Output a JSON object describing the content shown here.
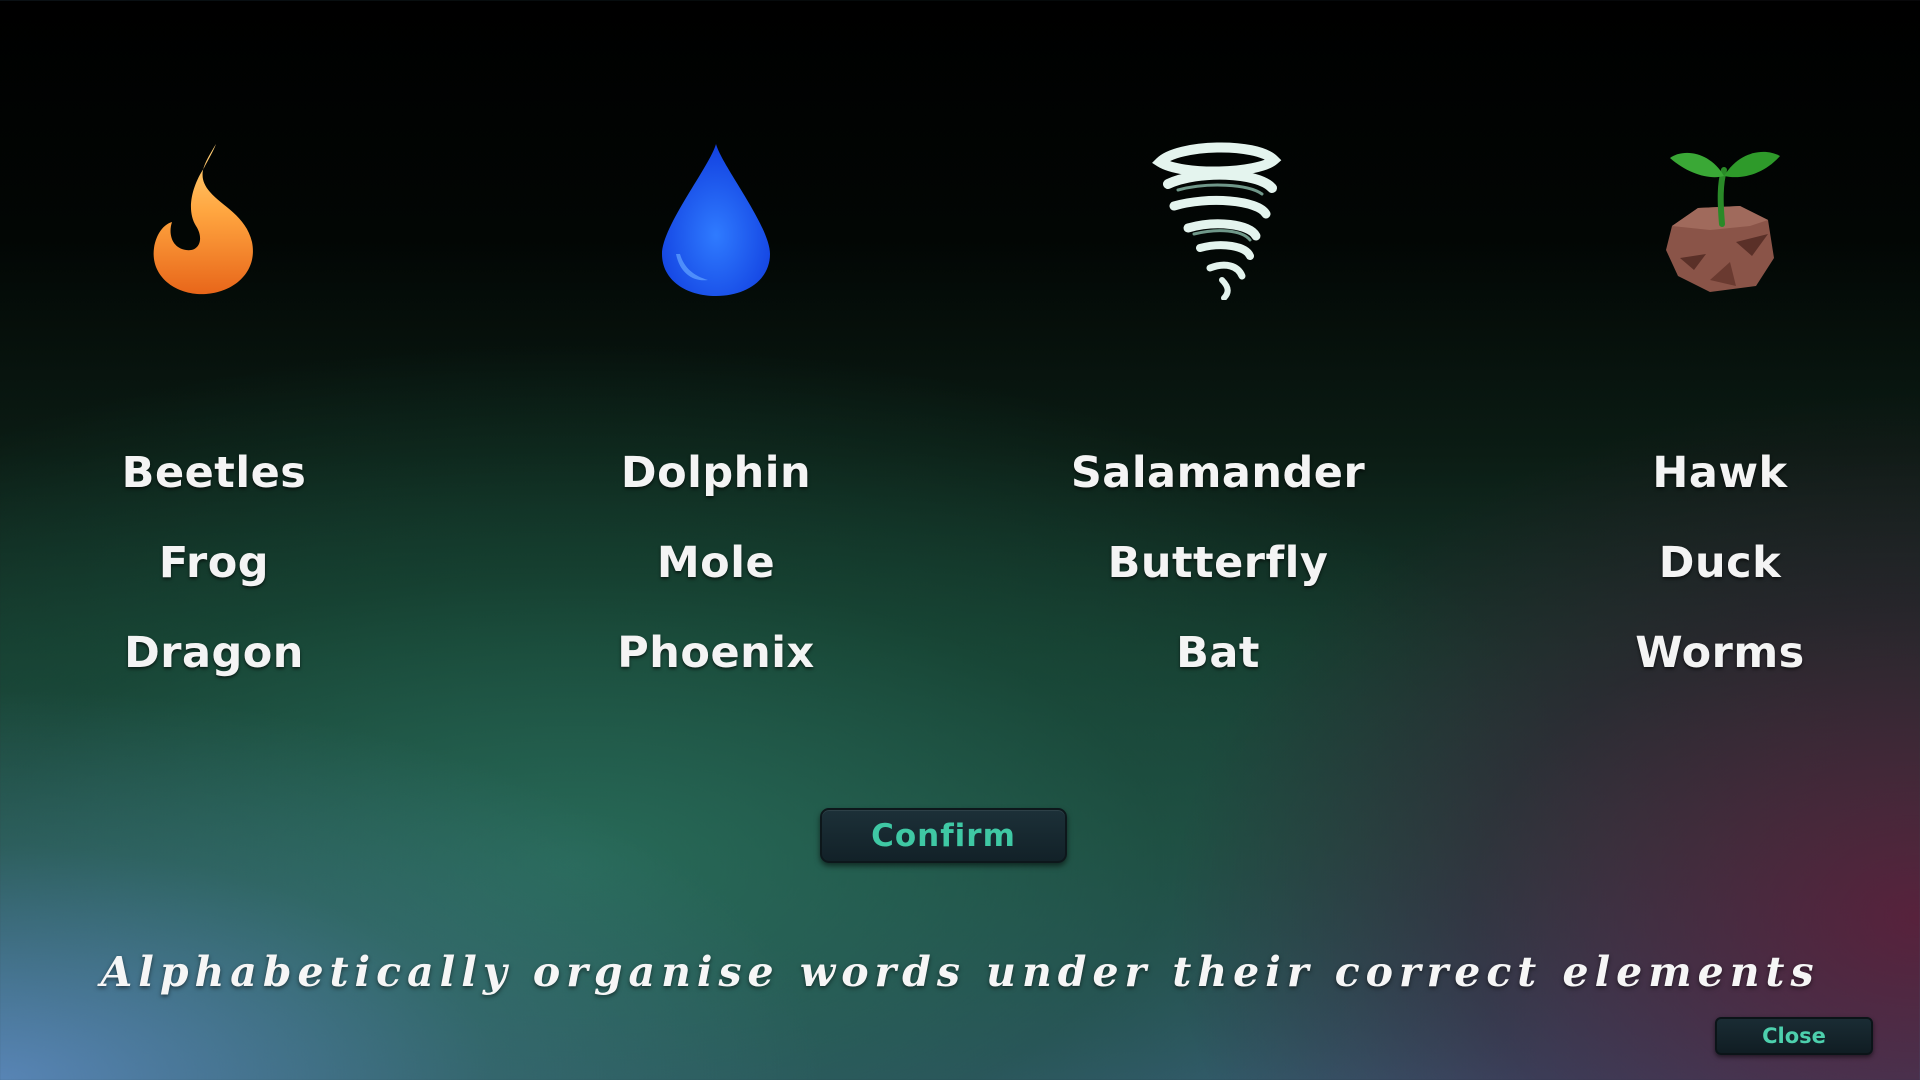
{
  "columns": [
    {
      "icon": "fire-icon",
      "words": [
        "Beetles",
        "Frog",
        "Dragon"
      ]
    },
    {
      "icon": "water-drop-icon",
      "words": [
        "Dolphin",
        "Mole",
        "Phoenix"
      ]
    },
    {
      "icon": "tornado-icon",
      "words": [
        "Salamander",
        "Butterfly",
        "Bat"
      ]
    },
    {
      "icon": "earth-sprout-icon",
      "words": [
        "Hawk",
        "Duck",
        "Worms"
      ]
    }
  ],
  "buttons": {
    "confirm": "Confirm",
    "close": "Close"
  },
  "instruction": "Alphabetically organise words under their correct elements",
  "colors": {
    "fire": "#f0802a",
    "water": "#1f5cff",
    "air": "#d8efe6",
    "earth": "#8a5448",
    "sprout": "#2e9a2a",
    "button_text": "#3fc8a4"
  }
}
